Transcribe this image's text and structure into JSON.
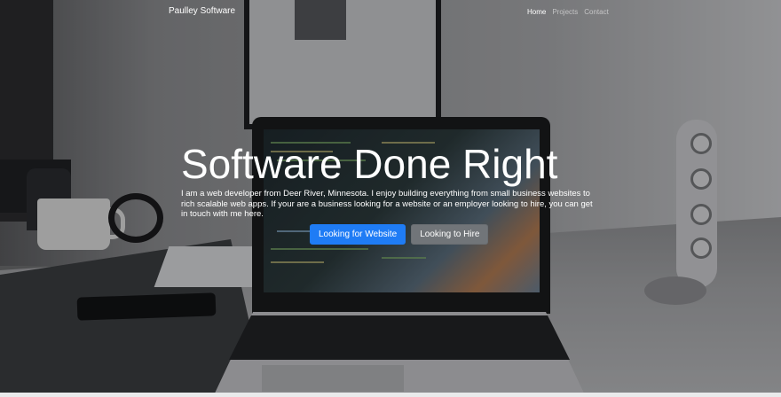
{
  "navbar": {
    "brand": "Paulley Software",
    "links": [
      {
        "label": "Home",
        "active": true
      },
      {
        "label": "Projects",
        "active": false
      },
      {
        "label": "Contact",
        "active": false
      }
    ]
  },
  "hero": {
    "title": "Software Done Right",
    "description": "I am a web developer from Deer River, Minnesota. I enjoy building everything from small business websites to rich scalable web apps. If your are a business looking for a website or an employer looking to hire, you can get in touch with me here.",
    "buttons": {
      "website": "Looking for Website",
      "hire": "Looking to Hire"
    }
  },
  "colors": {
    "primary_button": "#1f7cf5",
    "secondary_button": "#717579",
    "text": "#ffffff"
  }
}
